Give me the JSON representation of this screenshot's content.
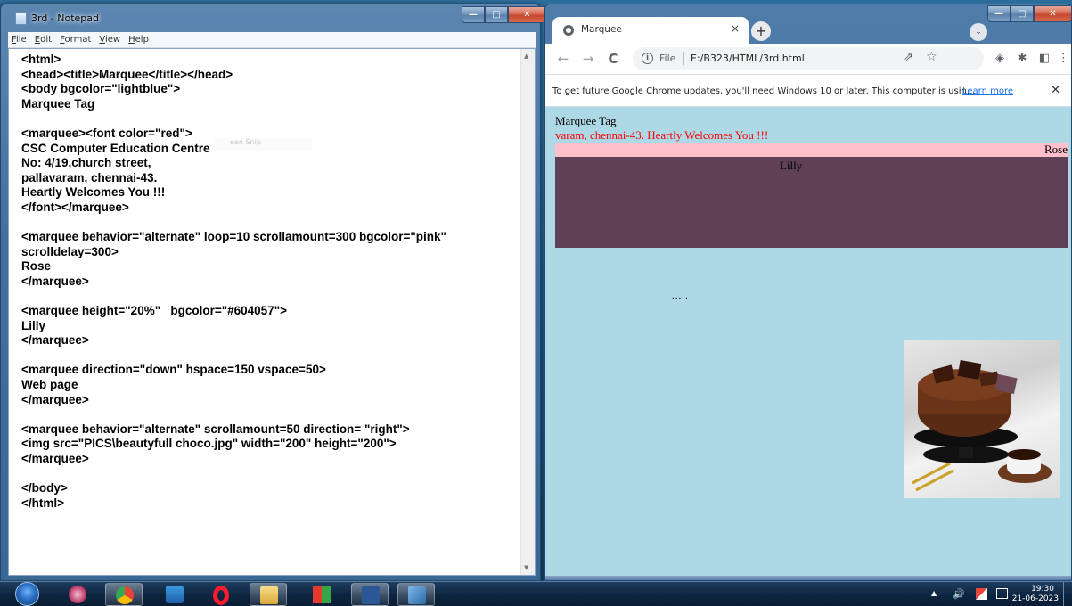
{
  "notepad": {
    "title": "3rd - Notepad",
    "caption_buttons": [
      "—",
      "□",
      "✕"
    ],
    "menu": [
      "File",
      "Edit",
      "Format",
      "View",
      "Help"
    ],
    "content": "<html>\n<head><title>Marquee</title></head>\n<body bgcolor=\"lightblue\">\nMarquee Tag\n\n<marquee><font color=\"red\">\nCSC Computer Education Centre\nNo: 4/19,church street,\npallavaram, chennai-43.\nHeartly Welcomes You !!!\n</font></marquee>\n\n<marquee behavior=\"alternate\" loop=10 scrollamount=300 bgcolor=\"pink\"\nscrolldelay=300>\nRose\n</marquee>\n\n<marquee height=\"20%\"   bgcolor=\"#604057\">\nLilly\n</marquee>\n\n<marquee direction=\"down\" hspace=150 vspace=50>\nWeb page\n</marquee>\n\n<marquee behavior=\"alternate\" scrollamount=50 direction= \"right\">\n<img src=\"PICS\\beautyfull choco.jpg\" width=\"200\" height=\"200\">\n</marquee>\n\n</body>\n</html>",
    "ghost_overlay": "een Snip"
  },
  "chrome": {
    "tab_title": "Marquee",
    "tab_close": "×",
    "new_tab": "+",
    "tab_search": "⌄",
    "nav": {
      "back": "←",
      "forward": "→",
      "reload": "C"
    },
    "address": {
      "scheme_label": "File",
      "url": "E:/B323/HTML/3rd.html"
    },
    "toolbar_icons": [
      "share-icon",
      "star-icon",
      "shield-extension-icon",
      "puzzle-icon",
      "side-panel-icon",
      "profile-icon",
      "kebab-menu-icon"
    ],
    "caption_buttons": [
      "—",
      "□",
      "✕"
    ],
    "infobar": {
      "message": "To get future Google Chrome updates, you'll need Windows 10 or later. This computer is usin...",
      "link": "Learn more",
      "close": "✕"
    },
    "page": {
      "bgcolor": "#add8e6",
      "heading": "Marquee Tag",
      "red_marquee_text": "varam, chennai-43. Heartly Welcomes You !!!",
      "red_color": "#ff0000",
      "pink_marquee_text": "Rose",
      "pink_color": "#ffc0cb",
      "lilly_marquee_text": "Lilly",
      "lilly_color": "#604057",
      "webpage_marquee_text": "... .",
      "image_subject": "chocolate cake"
    }
  },
  "taskbar": {
    "apps": [
      "start-orb",
      "snipping-tool-icon",
      "chrome-icon",
      "media-icon",
      "opera-icon",
      "file-explorer-icon",
      "color-blocks-icon",
      "word-icon",
      "app-icon"
    ],
    "clock_time": "19:30",
    "clock_date": "21-06-2023",
    "tray_arrow": "▲",
    "volume": "🔊"
  }
}
